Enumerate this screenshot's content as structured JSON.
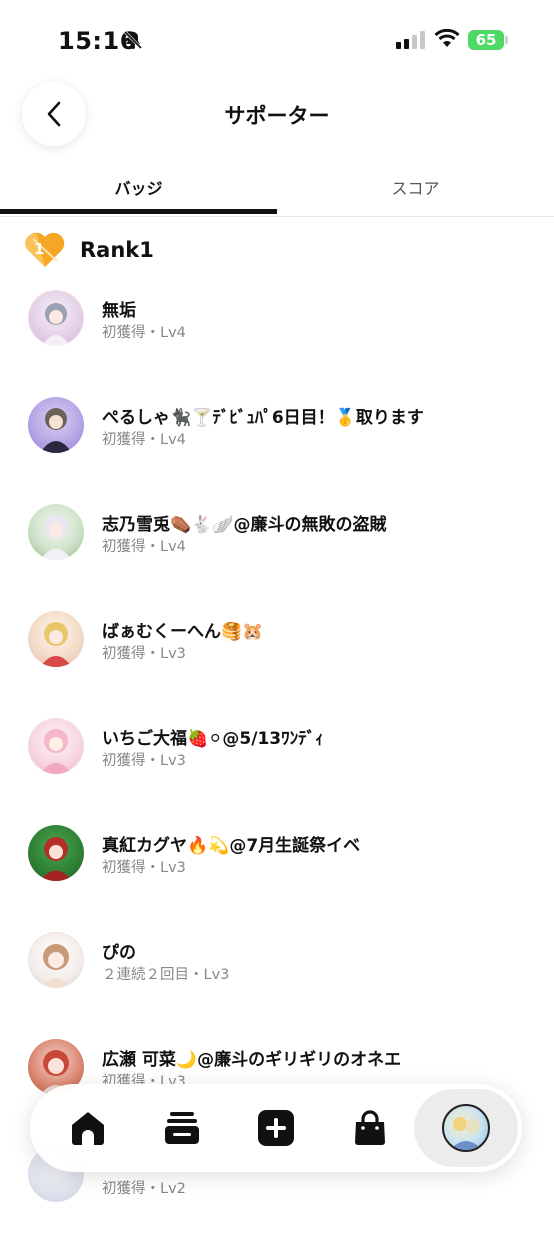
{
  "status_bar": {
    "time": "15:16",
    "battery": "65"
  },
  "header": {
    "title": "サポーター"
  },
  "tabs": [
    {
      "label": "バッジ",
      "active": true
    },
    {
      "label": "スコア",
      "active": false
    }
  ],
  "rank": {
    "badge_number": "1",
    "label": "Rank1"
  },
  "supporters": [
    {
      "name": "無垢",
      "sub": "初獲得・Lv4"
    },
    {
      "name": "ぺるしゃ🐈‍⬛🍸ﾃﾞﾋﾞｭﾊﾟ6日目！🥇取ります",
      "sub": "初獲得・Lv4"
    },
    {
      "name": "志乃雪兎⚰️🐇🪽@廉斗の無敗の盗賊",
      "sub": "初獲得・Lv4"
    },
    {
      "name": "ばぁむくーへん🥞🐹",
      "sub": "初獲得・Lv3"
    },
    {
      "name": "いちご大福🍓⚪@5/13ﾜﾝﾃﾞｨ",
      "sub": "初獲得・Lv3"
    },
    {
      "name": "真紅カグヤ🔥💫@7月生誕祭イベ",
      "sub": "初獲得・Lv3"
    },
    {
      "name": "ぴの",
      "sub": "２連続２回目・Lv3"
    },
    {
      "name": "広瀬 可菜🌙@廉斗のギリギリのオネエ",
      "sub": "初獲得・Lv3"
    },
    {
      "name": "",
      "sub": "初獲得・Lv2"
    }
  ],
  "nav": {
    "items": [
      "home-icon",
      "feed-icon",
      "add-icon",
      "bag-icon",
      "profile-avatar"
    ]
  },
  "colors": {
    "accent": "#111111",
    "rank_badge": "#f6a623",
    "battery": "#4cd964"
  }
}
